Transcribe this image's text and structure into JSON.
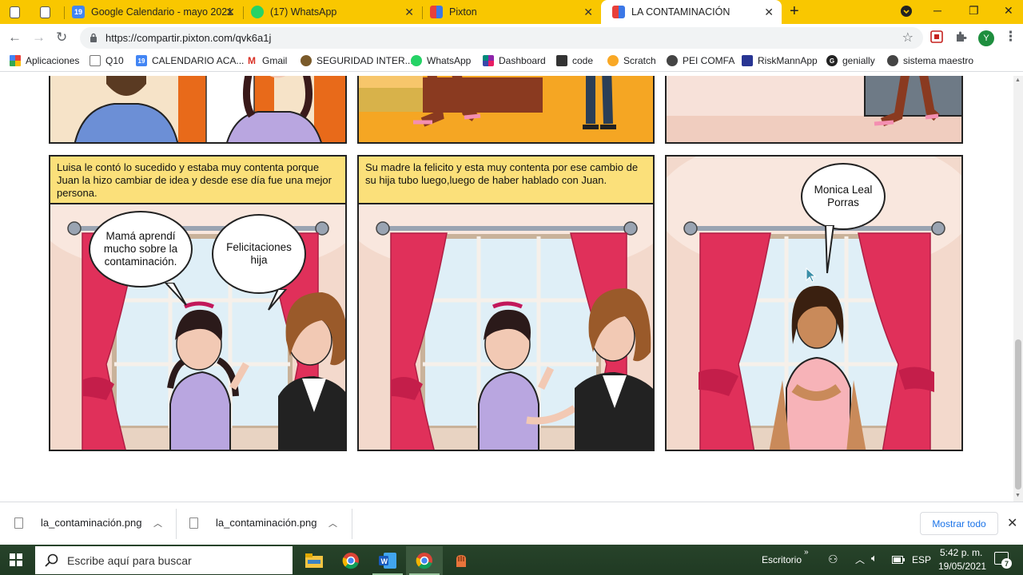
{
  "tabs": [
    {
      "title": "",
      "icon": "page-icon"
    },
    {
      "title": "",
      "icon": "page-icon"
    },
    {
      "title": "Google Calendario - mayo 2021",
      "icon": "calendar-icon",
      "badge": "19"
    },
    {
      "title": "(17) WhatsApp",
      "icon": "whatsapp-icon"
    },
    {
      "title": "Pixton",
      "icon": "pixton-icon"
    },
    {
      "title": "LA CONTAMINACIÓN",
      "icon": "pixton-icon",
      "active": true
    }
  ],
  "address": {
    "url": "https://compartir.pixton.com/qvk6a1j"
  },
  "profile_initial": "Y",
  "bookmarks": [
    {
      "label": "Aplicaciones",
      "icon": "apps-grid-icon"
    },
    {
      "label": "Q10",
      "icon": "q10-icon"
    },
    {
      "label": "CALENDARIO ACA...",
      "icon": "calendar-icon"
    },
    {
      "label": "Gmail",
      "icon": "gmail-icon"
    },
    {
      "label": "SEGURIDAD INTER...",
      "icon": "globe-icon"
    },
    {
      "label": "WhatsApp",
      "icon": "whatsapp-icon"
    },
    {
      "label": "Dashboard",
      "icon": "dashboard-icon"
    },
    {
      "label": "code",
      "icon": "code-icon"
    },
    {
      "label": "Scratch",
      "icon": "scratch-icon"
    },
    {
      "label": "PEI COMFA",
      "icon": "globe-icon"
    },
    {
      "label": "RiskMannApp",
      "icon": "riskmann-icon"
    },
    {
      "label": "genially",
      "icon": "genially-icon"
    },
    {
      "label": "sistema maestro",
      "icon": "globe-icon"
    }
  ],
  "comic": {
    "panel4": {
      "caption": "Luisa le contó lo sucedido y estaba muy contenta porque Juan la hizo cambiar de idea y desde ese día fue una mejor persona.",
      "bubble_left": "Mamá aprendí mucho sobre la contaminación.",
      "bubble_right": "Felicitaciones hija"
    },
    "panel5": {
      "caption": "Su madre la felicito y esta muy contenta por ese cambio de su hija tubo luego,luego de haber hablado con Juan."
    },
    "panel6": {
      "bubble": "Monica Leal Porras"
    }
  },
  "downloads": [
    {
      "file": "la_contaminación.png"
    },
    {
      "file": "la_contaminación.png"
    }
  ],
  "downloads_show_all": "Mostrar todo",
  "taskbar": {
    "search_placeholder": "Escribe aquí para buscar",
    "desktop_label": "Escritorio",
    "language": "ESP",
    "time": "5:42 p. m.",
    "date": "19/05/2021",
    "notification_count": "7"
  },
  "colors": {
    "tabstrip": "#f9c700",
    "caption_bg": "#fbe07a",
    "curtain": "#e0305a",
    "wall": "#f3d9cc"
  }
}
